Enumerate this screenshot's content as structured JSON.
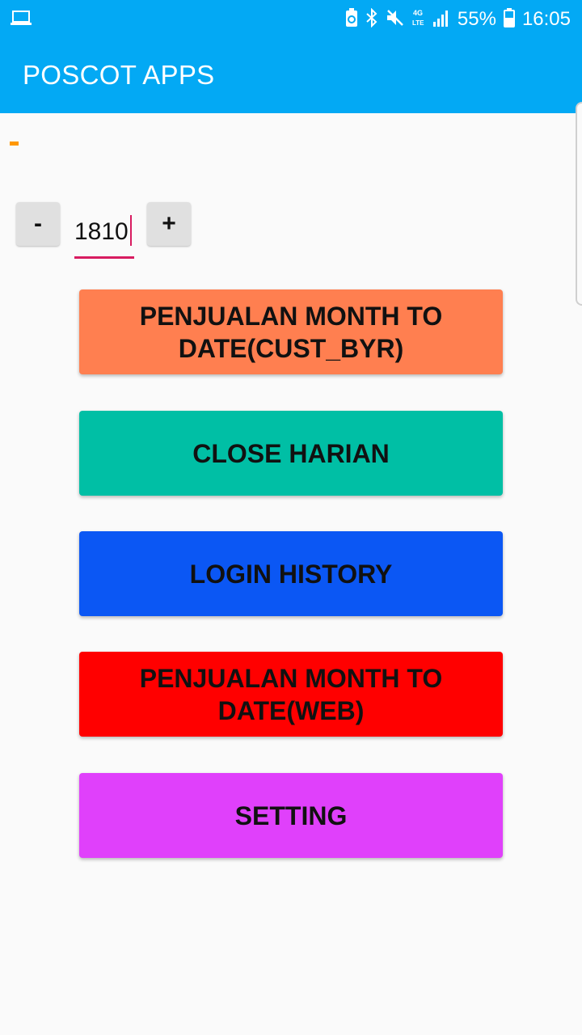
{
  "status_bar": {
    "battery_percent": "55%",
    "time": "16:05",
    "icons": [
      "laptop-icon",
      "battery-saver-icon",
      "bluetooth-icon",
      "mute-icon",
      "4g-lte-icon",
      "signal-icon",
      "battery-icon"
    ]
  },
  "app_bar": {
    "title": "POSCOT APPS",
    "color": "#03a9f4"
  },
  "stepper": {
    "minus_label": "-",
    "value": "1810",
    "plus_label": "+"
  },
  "menu": {
    "buttons": [
      {
        "label": "PENJUALAN MONTH TO DATE(CUST_BYR)",
        "color": "#ff7f50"
      },
      {
        "label": "CLOSE HARIAN",
        "color": "#00bfa5"
      },
      {
        "label": "LOGIN HISTORY",
        "color": "#0b57f4"
      },
      {
        "label": "PENJUALAN MONTH TO DATE(WEB)",
        "color": "#ff0000"
      },
      {
        "label": "SETTING",
        "color": "#e040fb"
      }
    ]
  }
}
